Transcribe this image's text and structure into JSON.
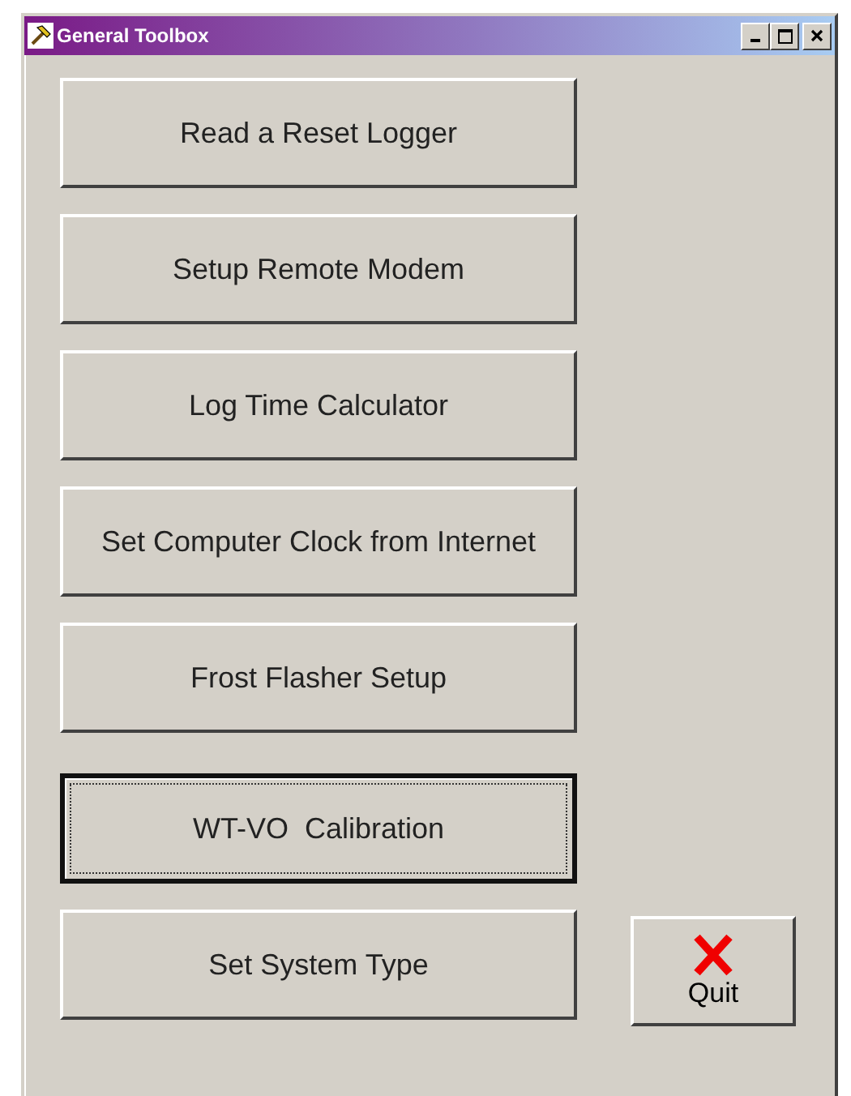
{
  "window": {
    "title": "General Toolbox"
  },
  "buttons": [
    {
      "label": "Read a Reset Logger",
      "focused": false
    },
    {
      "label": "Setup Remote Modem",
      "focused": false
    },
    {
      "label": "Log Time Calculator",
      "focused": false
    },
    {
      "label": "Set Computer Clock from Internet",
      "focused": false
    },
    {
      "label": "Frost Flasher Setup",
      "focused": false
    },
    {
      "label": "WT-VO  Calibration",
      "focused": true
    },
    {
      "label": "Set System Type",
      "focused": false
    }
  ],
  "quit_button": {
    "label": "Quit"
  }
}
